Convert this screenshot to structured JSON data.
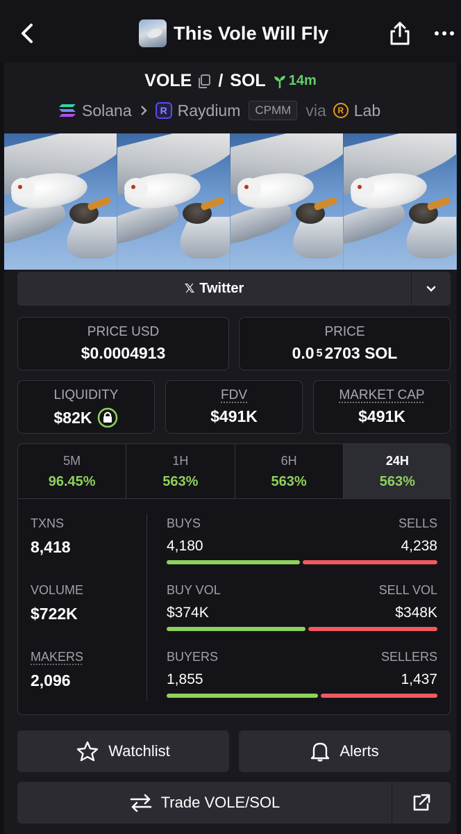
{
  "header": {
    "title": "This Vole Will Fly",
    "back_icon": "chevron-left-icon",
    "share_icon": "share-icon",
    "more_icon": "more-horizontal-icon"
  },
  "pair": {
    "base": "VOLE",
    "slash": "/",
    "quote": "SOL",
    "age": "14m"
  },
  "chain": {
    "chain_name": "Solana",
    "dex_name": "Raydium",
    "dex_tag": "CPMM",
    "via_label": "via",
    "launchpad": "Lab"
  },
  "social": {
    "twitter_label": "Twitter"
  },
  "price": {
    "usd_label": "PRICE USD",
    "usd_value": "$0.0004913",
    "native_label": "PRICE",
    "native_prefix": "0.0",
    "native_sub": "5",
    "native_rest": "2703 SOL"
  },
  "metrics": {
    "liquidity_label": "LIQUIDITY",
    "liquidity_value": "$82K",
    "fdv_label": "FDV",
    "fdv_value": "$491K",
    "mcap_label": "MARKET CAP",
    "mcap_value": "$491K"
  },
  "timeframes": [
    {
      "label": "5M",
      "value": "96.45%"
    },
    {
      "label": "1H",
      "value": "563%"
    },
    {
      "label": "6H",
      "value": "563%"
    },
    {
      "label": "24H",
      "value": "563%"
    }
  ],
  "stats": {
    "txns_label": "TXNS",
    "txns_value": "8,418",
    "volume_label": "VOLUME",
    "volume_value": "$722K",
    "makers_label": "MAKERS",
    "makers_value": "2,096",
    "buys_label": "BUYS",
    "buys_value": "4,180",
    "sells_label": "SELLS",
    "sells_value": "4,238",
    "buy_vol_label": "BUY VOL",
    "buy_vol_value": "$374K",
    "sell_vol_label": "SELL VOL",
    "sell_vol_value": "$348K",
    "buyers_label": "BUYERS",
    "buyers_value": "1,855",
    "sellers_label": "SELLERS",
    "sellers_value": "1,437"
  },
  "actions": {
    "watchlist_label": "Watchlist",
    "alerts_label": "Alerts",
    "trade_label": "Trade VOLE/SOL"
  },
  "colors": {
    "green": "#8ed25b",
    "red": "#ef5a5f",
    "age_green": "#5fd06a"
  }
}
